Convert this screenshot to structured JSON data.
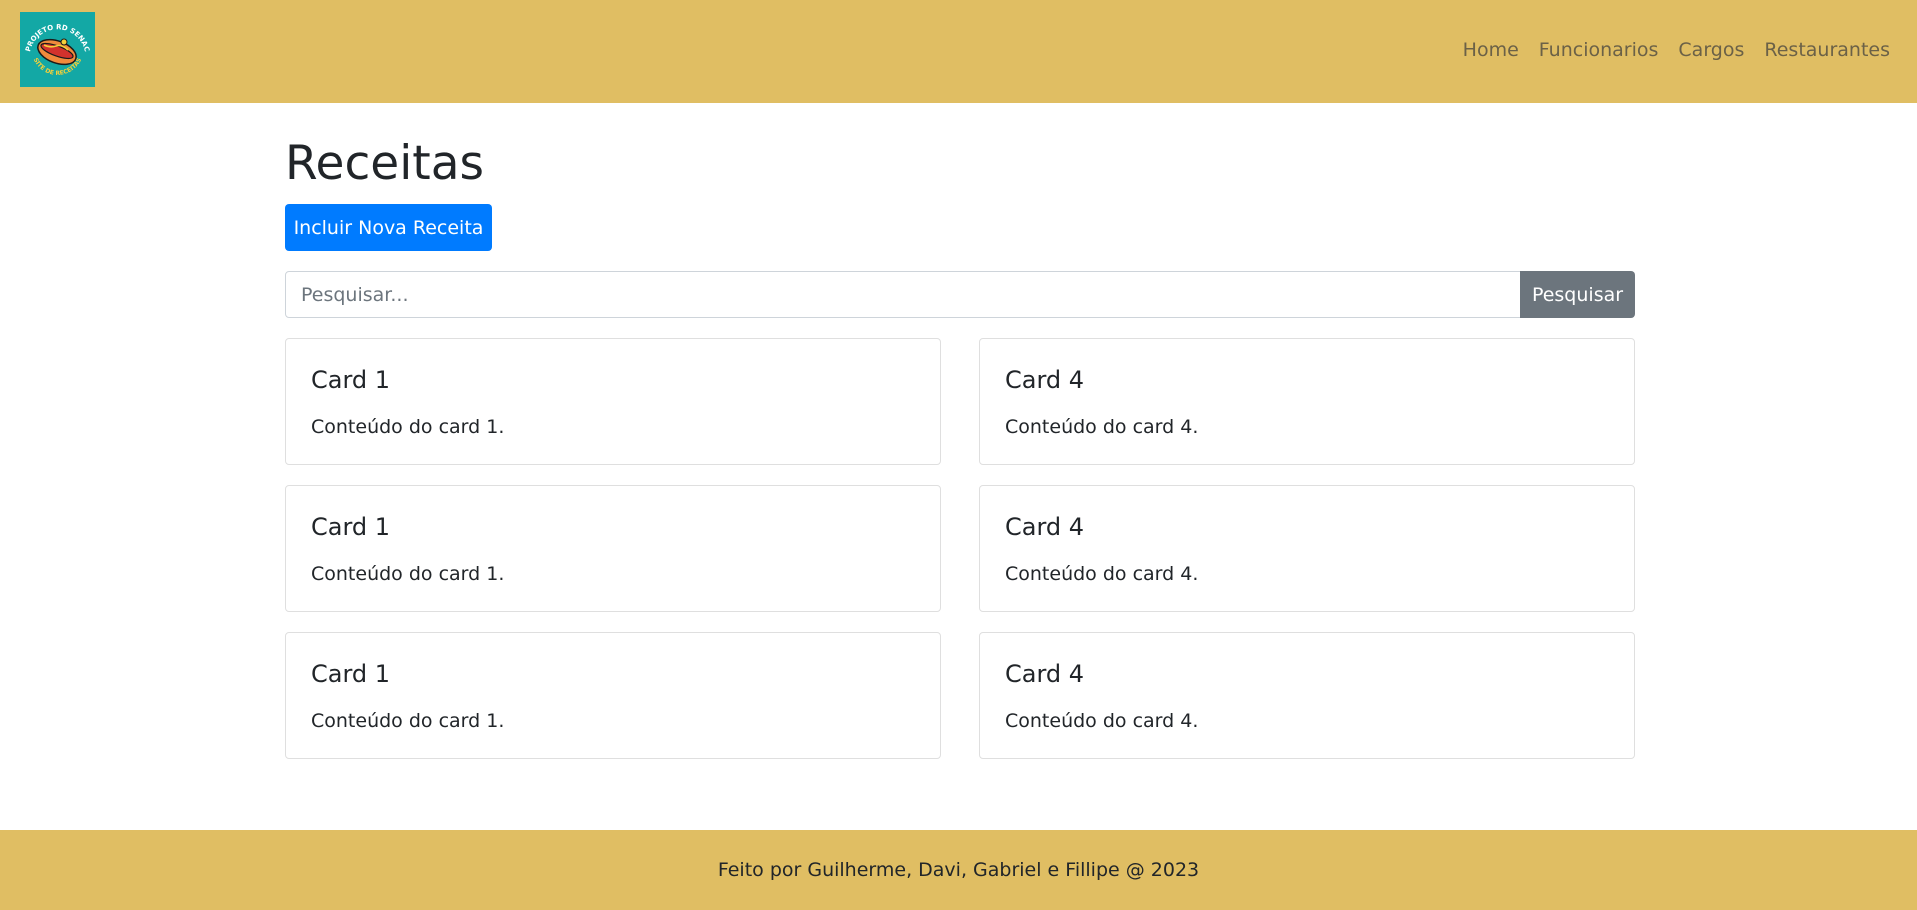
{
  "navbar": {
    "logo_top_text": "PROJETO RD SENAC",
    "logo_bottom_text": "SITE DE RECEITAS",
    "links": [
      "Home",
      "Funcionarios",
      "Cargos",
      "Restaurantes"
    ]
  },
  "main": {
    "title": "Receitas",
    "add_button_label": "Incluir Nova Receita",
    "search": {
      "placeholder": "Pesquisar...",
      "value": "",
      "button_label": "Pesquisar"
    },
    "cards": [
      {
        "title": "Card 1",
        "text": "Conteúdo do card 1."
      },
      {
        "title": "Card 4",
        "text": "Conteúdo do card 4."
      },
      {
        "title": "Card 1",
        "text": "Conteúdo do card 1."
      },
      {
        "title": "Card 4",
        "text": "Conteúdo do card 4."
      },
      {
        "title": "Card 1",
        "text": "Conteúdo do card 1."
      },
      {
        "title": "Card 4",
        "text": "Conteúdo do card 4."
      }
    ]
  },
  "footer": {
    "text": "Feito por Guilherme, Davi, Gabriel e Fillipe @ 2023"
  },
  "colors": {
    "navbar_bg": "#e0be63",
    "primary_button": "#007bff",
    "secondary_button": "#6c757d",
    "logo_bg": "#13a8a5"
  }
}
